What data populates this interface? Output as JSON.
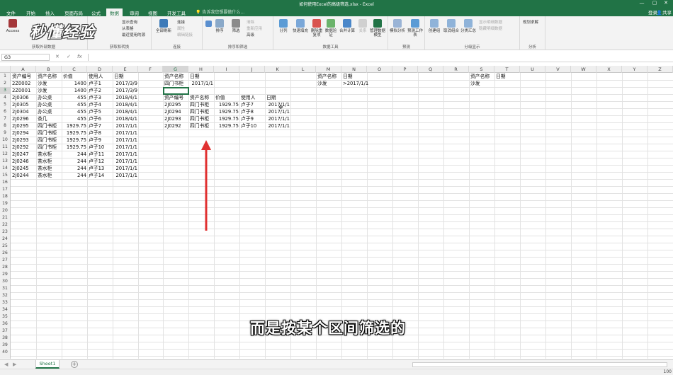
{
  "window": {
    "title": "如何使用Excel的高级筛选.xlsx - Excel",
    "controls": [
      "—",
      "▢",
      "✕"
    ]
  },
  "menu": {
    "tabs": [
      "文件",
      "开始",
      "插入",
      "页面布局",
      "公式",
      "数据",
      "审阅",
      "视图",
      "开发工具"
    ],
    "active_index": 5,
    "tell_me": "告诉我您想要做什么...",
    "account": "登录",
    "share": "共享"
  },
  "ribbon": {
    "get_external": {
      "access": "Access",
      "label": "获取外部数据"
    },
    "transform": {
      "new_query": "新建查询",
      "items": [
        "显示查询",
        "从表格",
        "最近使用的源"
      ],
      "label": "获取和转换"
    },
    "connections": {
      "refresh": "全部刷新",
      "items": [
        "连接",
        "属性",
        "编辑链接"
      ],
      "label": "连接"
    },
    "sort_filter": {
      "sort": "排序",
      "filter": "筛选",
      "items": [
        "清除",
        "重新应用",
        "高级"
      ],
      "label": "排序和筛选"
    },
    "data_tools": {
      "buttons": [
        "分列",
        "快速填充",
        "删除重复项",
        "数据验证",
        "合并计算",
        "关系",
        "管理数据模型"
      ],
      "label": "数据工具"
    },
    "forecast": {
      "buttons": [
        "模拟分析",
        "预测工作表"
      ],
      "label": "预测"
    },
    "outline": {
      "buttons": [
        "创建组",
        "取消组合",
        "分类汇总"
      ],
      "items": [
        "显示明细数据",
        "隐藏明细数据"
      ],
      "label": "分级显示"
    },
    "analysis": {
      "solver": "规划求解",
      "label": "分析"
    }
  },
  "formula_bar": {
    "name_box": "G3",
    "cancel": "✕",
    "enter": "✓",
    "fx": "fx",
    "value": ""
  },
  "columns": [
    "A",
    "B",
    "C",
    "D",
    "E",
    "F",
    "G",
    "H",
    "I",
    "J",
    "K",
    "L",
    "M",
    "N",
    "O",
    "P",
    "Q",
    "R",
    "S",
    "T",
    "U",
    "V",
    "W",
    "X",
    "Y",
    "Z"
  ],
  "rows": [
    "1",
    "2",
    "3",
    "4",
    "5",
    "6",
    "7",
    "8",
    "9",
    "10",
    "11",
    "12",
    "13",
    "14",
    "15",
    "16",
    "17",
    "18",
    "19",
    "20",
    "21",
    "22",
    "23",
    "24",
    "25",
    "26",
    "27",
    "28",
    "29",
    "30",
    "31",
    "32",
    "33",
    "34",
    "35",
    "36",
    "37",
    "38",
    "39",
    "40"
  ],
  "source_table": {
    "headers": [
      "资产编号",
      "资产名称",
      "价值",
      "使用人",
      "日期"
    ],
    "rows": [
      [
        "2Z0002",
        "沙发",
        "1400",
        "卢子1",
        "2017/3/9"
      ],
      [
        "2Z0001",
        "沙发",
        "1400",
        "卢子2",
        "2017/3/9"
      ],
      [
        "2J0306",
        "办公桌",
        "455",
        "卢子3",
        "2018/4/1"
      ],
      [
        "2J0305",
        "办公桌",
        "455",
        "卢子4",
        "2018/4/1"
      ],
      [
        "2J0304",
        "办公桌",
        "455",
        "卢子5",
        "2018/4/1"
      ],
      [
        "2J0296",
        "茶几",
        "455",
        "卢子6",
        "2018/4/1"
      ],
      [
        "2J0295",
        "四门书柜",
        "1929.75",
        "卢子7",
        "2017/1/1"
      ],
      [
        "2J0294",
        "四门书柜",
        "1929.75",
        "卢子8",
        "2017/1/1"
      ],
      [
        "2J0293",
        "四门书柜",
        "1929.75",
        "卢子9",
        "2017/1/1"
      ],
      [
        "2J0292",
        "四门书柜",
        "1929.75",
        "卢子10",
        "2017/1/1"
      ],
      [
        "2J0247",
        "茶水柜",
        "244",
        "卢子11",
        "2017/1/1"
      ],
      [
        "2J0246",
        "茶水柜",
        "244",
        "卢子12",
        "2017/1/1"
      ],
      [
        "2J0245",
        "茶水柜",
        "244",
        "卢子13",
        "2017/1/1"
      ],
      [
        "2J0244",
        "茶水柜",
        "244",
        "卢子14",
        "2017/1/1"
      ]
    ]
  },
  "criteria1": {
    "headers": [
      "资产名称",
      "日期"
    ],
    "values": [
      "四门书柜",
      "2017/1/1"
    ]
  },
  "result_table": {
    "headers": [
      "资产编号",
      "资产名称",
      "价值",
      "使用人",
      "日期"
    ],
    "rows": [
      [
        "2J0295",
        "四门书柜",
        "1929.75",
        "卢子7",
        "2017/1/1"
      ],
      [
        "2J0294",
        "四门书柜",
        "1929.75",
        "卢子8",
        "2017/1/1"
      ],
      [
        "2J0293",
        "四门书柜",
        "1929.75",
        "卢子9",
        "2017/1/1"
      ],
      [
        "2J0292",
        "四门书柜",
        "1929.75",
        "卢子10",
        "2017/1/1"
      ]
    ]
  },
  "criteria2": {
    "headers": [
      "资产名称",
      "日期"
    ],
    "values": [
      "沙发",
      ">2017/1/1"
    ]
  },
  "criteria3": {
    "headers": [
      "资产名称",
      "日期"
    ],
    "values": [
      "沙发"
    ]
  },
  "sheet": {
    "tab": "Sheet1",
    "add": "+"
  },
  "status": {
    "zoom": "100"
  },
  "overlay": {
    "logo": "秒懂经验",
    "subtitle": "而是按某个区间筛选的"
  },
  "colors": {
    "accent": "#217346",
    "arrow": "#e03030"
  }
}
